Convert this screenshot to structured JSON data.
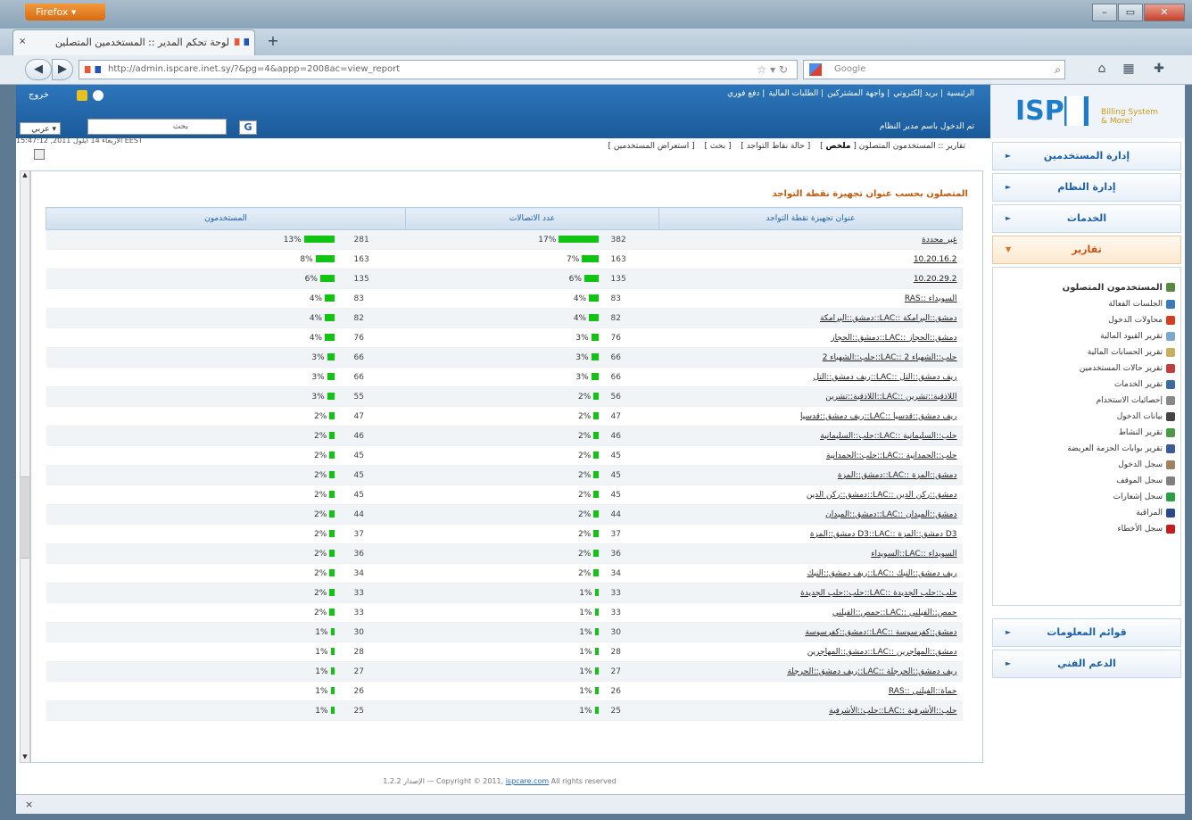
{
  "browser": {
    "app_button": "Firefox",
    "tab_title": "لوحة تحكم المدير :: المستخدمين المتصلين",
    "url": "http://admin.ispcare.inet.sy/?&pg=4&appp=2008ac=view_report",
    "search_engine": "Google",
    "close_tab": "×"
  },
  "header": {
    "logo_text": "ISP",
    "logo_box": "Care",
    "logo_sub1": "Billing System",
    "logo_sub2": "& More!",
    "top_nav": [
      "الرئيسية",
      "بريد إلكتروني",
      "واجهة المشتركين",
      "الطلبات المالية",
      "دفع فوري"
    ],
    "welcome": "تم الدخول باسم مدير النظام",
    "left_label": "خروج",
    "search_label": "بحث",
    "search_button": "G",
    "language": "عربي"
  },
  "sidebar": {
    "sections": [
      {
        "label": "إدارة المستخدمين"
      },
      {
        "label": "إدارة النظام"
      },
      {
        "label": "الخدمات"
      },
      {
        "label": "تقارير"
      }
    ],
    "report_items": [
      "المستخدمون المتصلون",
      "الجلسات الفعالة",
      "محاولات الدخول",
      "تقرير القيود المالية",
      "تقرير الحسابات المالية",
      "تقرير حالات المستخدمين",
      "تقرير الخدمات",
      "إحصائيات الاستخدام",
      "بيانات الدخول",
      "تقرير النشاط",
      "تقرير بوابات الحزمة العريضة",
      "سجل الدخول",
      "سجل الموقف",
      "سجل إشعارات",
      "المراقبة",
      "سجل الأخطاء"
    ],
    "bottom_sections": [
      {
        "label": "قوائم المعلومات"
      },
      {
        "label": "الدعم الفني"
      }
    ]
  },
  "content": {
    "breadcrumb_prefix": "تقارير :: المستخدمون المتصلون",
    "breadcrumb_links": [
      "ملخص",
      "حالة نقاط التواجد",
      "بحث",
      "استعراض المستخدمين"
    ],
    "date": "الأربعاء 14 أيلول 2011, 15:47:12 EEST",
    "table_title": "المتصلون بحسب عنوان تجهيزة نقطة التواجد",
    "columns": [
      "عنوان تجهيزة نقطة التواجد",
      "عدد الاتصالات",
      "المستخدمون"
    ],
    "rows": [
      {
        "name": "غير محددة",
        "conn": 382,
        "conn_pct": 17,
        "users": 281,
        "users_pct": 13
      },
      {
        "name": "10.20.16.2",
        "conn": 163,
        "conn_pct": 7,
        "users": 163,
        "users_pct": 8
      },
      {
        "name": "10.20.29.2",
        "conn": 135,
        "conn_pct": 6,
        "users": 135,
        "users_pct": 6
      },
      {
        "name": "RAS:: السويداء",
        "conn": 83,
        "conn_pct": 4,
        "users": 83,
        "users_pct": 4
      },
      {
        "name": "دمشق::البرامكة::LAC:: دمشق::البرامكة",
        "conn": 82,
        "conn_pct": 4,
        "users": 82,
        "users_pct": 4
      },
      {
        "name": "دمشق::الحجاز::LAC:: دمشق::الحجاز",
        "conn": 76,
        "conn_pct": 3,
        "users": 76,
        "users_pct": 4
      },
      {
        "name": "حلب::الشهباء 2::LAC:: حلب::الشهباء 2",
        "conn": 66,
        "conn_pct": 3,
        "users": 66,
        "users_pct": 3
      },
      {
        "name": "ريف دمشق::التل::LAC:: ريف دمشق::التل",
        "conn": 66,
        "conn_pct": 3,
        "users": 66,
        "users_pct": 3
      },
      {
        "name": "اللاذقية::تشرين::LAC:: اللاذقية::تشرين",
        "conn": 56,
        "conn_pct": 2,
        "users": 55,
        "users_pct": 3
      },
      {
        "name": "ريف دمشق::قدسيا::LAC:: ريف دمشق::قدسيا",
        "conn": 47,
        "conn_pct": 2,
        "users": 47,
        "users_pct": 2
      },
      {
        "name": "حلب::السليمانية::LAC:: حلب::السليمانية",
        "conn": 46,
        "conn_pct": 2,
        "users": 46,
        "users_pct": 2
      },
      {
        "name": "حلب::الحمدانية::LAC:: حلب::الحمدانية",
        "conn": 45,
        "conn_pct": 2,
        "users": 45,
        "users_pct": 2
      },
      {
        "name": "دمشق::المزة::LAC:: دمشق::المزة",
        "conn": 45,
        "conn_pct": 2,
        "users": 45,
        "users_pct": 2
      },
      {
        "name": "دمشق::ركن الدين::LAC:: دمشق::ركن الدين",
        "conn": 45,
        "conn_pct": 2,
        "users": 45,
        "users_pct": 2
      },
      {
        "name": "دمشق::الميدان::LAC:: دمشق::الميدان",
        "conn": 44,
        "conn_pct": 2,
        "users": 44,
        "users_pct": 2
      },
      {
        "name": "دمشق::المزة D3::LAC:: دمشق::المزة D3",
        "conn": 37,
        "conn_pct": 2,
        "users": 37,
        "users_pct": 2
      },
      {
        "name": "السويداء::LAC:: السويداء",
        "conn": 36,
        "conn_pct": 2,
        "users": 36,
        "users_pct": 2
      },
      {
        "name": "ريف دمشق::النبك::LAC:: ريف دمشق::النبك",
        "conn": 34,
        "conn_pct": 2,
        "users": 34,
        "users_pct": 2
      },
      {
        "name": "حلب::حلب الجديدة::LAC:: حلب::حلب الجديدة",
        "conn": 33,
        "conn_pct": 1,
        "users": 33,
        "users_pct": 2
      },
      {
        "name": "حمص::الفيلني::LAC:: حمص::الفيلني",
        "conn": 33,
        "conn_pct": 1,
        "users": 33,
        "users_pct": 2
      },
      {
        "name": "دمشق::كفرسوسة::LAC:: دمشق::كفرسوسة",
        "conn": 30,
        "conn_pct": 1,
        "users": 30,
        "users_pct": 1
      },
      {
        "name": "دمشق::المهاجرين::LAC:: دمشق::المهاجرين",
        "conn": 28,
        "conn_pct": 1,
        "users": 28,
        "users_pct": 1
      },
      {
        "name": "ريف دمشق::الحرجلة::LAC:: ريف دمشق::الحرجلة",
        "conn": 27,
        "conn_pct": 1,
        "users": 27,
        "users_pct": 1
      },
      {
        "name": "RAS:: حماة::الفيلني",
        "conn": 26,
        "conn_pct": 1,
        "users": 26,
        "users_pct": 1
      },
      {
        "name": "حلب::الأشرفية::LAC:: حلب::الأشرفية",
        "conn": 25,
        "conn_pct": 1,
        "users": 25,
        "users_pct": 1
      }
    ],
    "footer_version": "الإصدار 1.2.2",
    "footer_copyright": "— Copyright © 2011,",
    "footer_link": "ispcare.com",
    "footer_rights": "All rights reserved"
  },
  "status": {
    "close": "×"
  }
}
